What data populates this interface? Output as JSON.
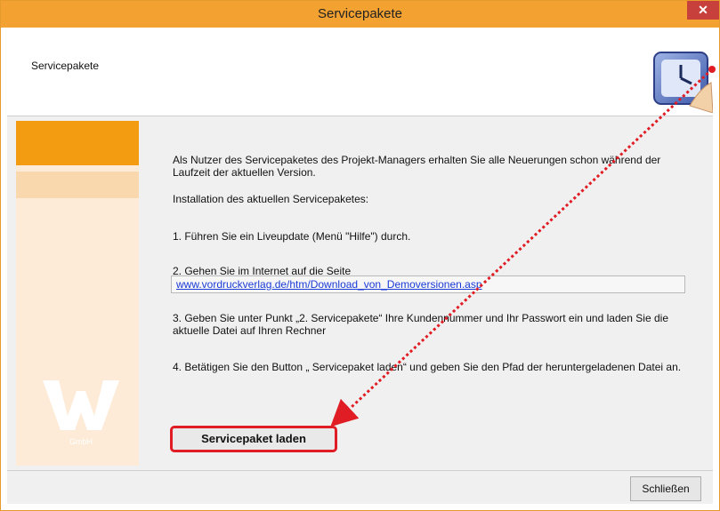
{
  "window": {
    "title": "Servicepakete",
    "close_symbol": "✕"
  },
  "header": {
    "title": "Servicepakete",
    "icon": "clock-icon"
  },
  "content": {
    "intro": "Als Nutzer des Servicepaketes des Projekt-Managers erhalten Sie alle Neuerungen schon während der Laufzeit der aktuellen Version.",
    "install_heading": "Installation des aktuellen Servicepaketes:",
    "step1": "1. Führen Sie ein Liveupdate (Menü \"Hilfe\") durch.",
    "step2": "2. Gehen Sie im Internet auf die Seite",
    "url": "www.vordruckverlag.de/htm/Download_von_Demoversionen.asp",
    "step3": "3. Geben Sie unter Punkt „2. Servicepakete“ Ihre Kundennummer und Ihr Passwort ein und laden Sie die aktuelle Datei auf Ihren Rechner",
    "step4": "4. Betätigen Sie den Button „ Servicepaket laden“ und geben Sie den Pfad der heruntergeladenen Datei an."
  },
  "buttons": {
    "load": "Servicepaket laden",
    "close": "Schließen"
  },
  "colors": {
    "accent_orange": "#f3a231",
    "sidebar_orange": "#f39c12",
    "highlight_red": "#e01c24"
  }
}
